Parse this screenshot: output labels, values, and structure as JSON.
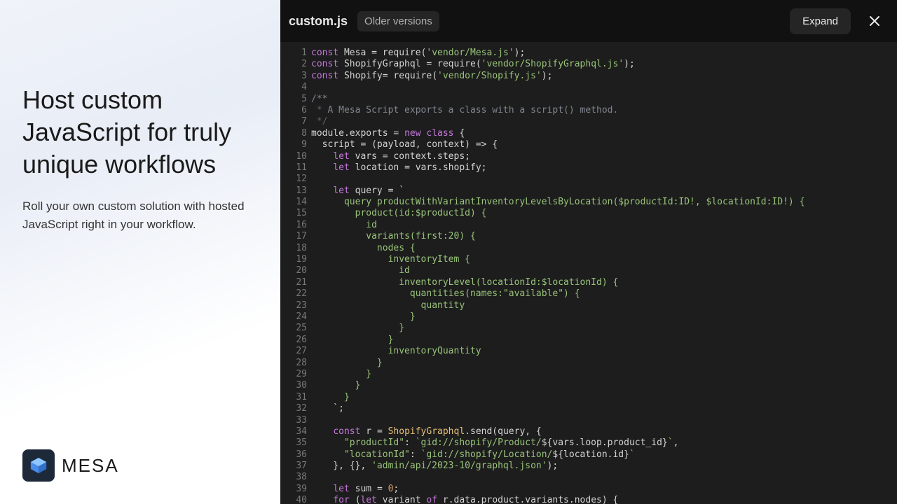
{
  "hero": {
    "title": "Host custom JavaScript for truly unique workflows",
    "subtitle": "Roll your own custom solution with hosted JavaScript right in your workflow."
  },
  "brand": {
    "name": "MESA"
  },
  "topbar": {
    "filename": "custom.js",
    "older_versions": "Older versions",
    "expand": "Expand"
  },
  "code": {
    "lines": [
      [
        {
          "c": "kw",
          "t": "const"
        },
        {
          "t": " Mesa "
        },
        {
          "t": "="
        },
        {
          "t": " require("
        },
        {
          "c": "str",
          "t": "'vendor/Mesa.js'"
        },
        {
          "t": ");"
        }
      ],
      [
        {
          "c": "kw",
          "t": "const"
        },
        {
          "t": " ShopifyGraphql "
        },
        {
          "t": "="
        },
        {
          "t": " require("
        },
        {
          "c": "str",
          "t": "'vendor/ShopifyGraphql.js'"
        },
        {
          "t": ");"
        }
      ],
      [
        {
          "c": "kw",
          "t": "const"
        },
        {
          "t": " Shopify"
        },
        {
          "t": "="
        },
        {
          "t": " require("
        },
        {
          "c": "str",
          "t": "'vendor/Shopify.js'"
        },
        {
          "t": ");"
        }
      ],
      [],
      [
        {
          "c": "com",
          "t": "/**"
        }
      ],
      [
        {
          "c": "com-bar",
          "t": " *"
        },
        {
          "c": "com",
          "t": " A Mesa Script exports a class with a script() method."
        }
      ],
      [
        {
          "c": "com-bar",
          "t": " */"
        }
      ],
      [
        {
          "t": "module.exports "
        },
        {
          "t": "="
        },
        {
          "t": " "
        },
        {
          "c": "new",
          "t": "new"
        },
        {
          "t": " "
        },
        {
          "c": "kw",
          "t": "class"
        },
        {
          "t": " {"
        }
      ],
      [
        {
          "t": "  script "
        },
        {
          "t": "="
        },
        {
          "t": " (payload, context) "
        },
        {
          "t": "=>"
        },
        {
          "t": " {"
        }
      ],
      [
        {
          "t": "    "
        },
        {
          "c": "kw",
          "t": "let"
        },
        {
          "t": " vars "
        },
        {
          "t": "="
        },
        {
          "t": " context.steps;"
        }
      ],
      [
        {
          "t": "    "
        },
        {
          "c": "kw",
          "t": "let"
        },
        {
          "t": " location "
        },
        {
          "t": "="
        },
        {
          "t": " vars.shopify;"
        }
      ],
      [],
      [
        {
          "t": "    "
        },
        {
          "c": "kw",
          "t": "let"
        },
        {
          "t": " query "
        },
        {
          "t": "="
        },
        {
          "t": " `"
        }
      ],
      [
        {
          "t": "      "
        },
        {
          "c": "tpl",
          "t": "query productWithVariantInventoryLevelsByLocation($productId:ID!, $locationId:ID!) {"
        }
      ],
      [
        {
          "t": "        "
        },
        {
          "c": "tpl",
          "t": "product(id:$productId) {"
        }
      ],
      [
        {
          "t": "          "
        },
        {
          "c": "tpl",
          "t": "id"
        }
      ],
      [
        {
          "t": "          "
        },
        {
          "c": "tpl",
          "t": "variants(first:20) {"
        }
      ],
      [
        {
          "t": "            "
        },
        {
          "c": "tpl",
          "t": "nodes {"
        }
      ],
      [
        {
          "t": "              "
        },
        {
          "c": "tpl",
          "t": "inventoryItem {"
        }
      ],
      [
        {
          "t": "                "
        },
        {
          "c": "tpl",
          "t": "id"
        }
      ],
      [
        {
          "t": "                "
        },
        {
          "c": "tpl",
          "t": "inventoryLevel(locationId:$locationId) {"
        }
      ],
      [
        {
          "t": "                  "
        },
        {
          "c": "tpl",
          "t": "quantities(names:\"available\") {"
        }
      ],
      [
        {
          "t": "                    "
        },
        {
          "c": "tpl",
          "t": "quantity"
        }
      ],
      [
        {
          "t": "                  "
        },
        {
          "c": "tpl",
          "t": "}"
        }
      ],
      [
        {
          "t": "                "
        },
        {
          "c": "tpl",
          "t": "}"
        }
      ],
      [
        {
          "t": "              "
        },
        {
          "c": "tpl",
          "t": "}"
        }
      ],
      [
        {
          "t": "              "
        },
        {
          "c": "tpl",
          "t": "inventoryQuantity"
        }
      ],
      [
        {
          "t": "            "
        },
        {
          "c": "tpl",
          "t": "}"
        }
      ],
      [
        {
          "t": "          "
        },
        {
          "c": "tpl",
          "t": "}"
        }
      ],
      [
        {
          "t": "        "
        },
        {
          "c": "tpl",
          "t": "}"
        }
      ],
      [
        {
          "t": "      "
        },
        {
          "c": "tpl",
          "t": "}"
        }
      ],
      [
        {
          "t": "    `;"
        }
      ],
      [],
      [
        {
          "t": "    "
        },
        {
          "c": "kw",
          "t": "const"
        },
        {
          "t": " r "
        },
        {
          "t": "="
        },
        {
          "t": " "
        },
        {
          "c": "fn",
          "t": "ShopifyGraphql"
        },
        {
          "t": ".send(query, {"
        }
      ],
      [
        {
          "t": "      "
        },
        {
          "c": "str",
          "t": "\"productId\""
        },
        {
          "t": ": "
        },
        {
          "c": "tpl",
          "t": "`gid://shopify/Product/"
        },
        {
          "t": "${vars.loop.product_id}"
        },
        {
          "c": "tpl",
          "t": "`"
        },
        {
          "t": ","
        }
      ],
      [
        {
          "t": "      "
        },
        {
          "c": "str",
          "t": "\"locationId\""
        },
        {
          "t": ": "
        },
        {
          "c": "tpl",
          "t": "`gid://shopify/Location/"
        },
        {
          "t": "${location.id}"
        },
        {
          "c": "tpl",
          "t": "`"
        }
      ],
      [
        {
          "t": "    }, {}, "
        },
        {
          "c": "str",
          "t": "'admin/api/2023-10/graphql.json'"
        },
        {
          "t": ");"
        }
      ],
      [],
      [
        {
          "t": "    "
        },
        {
          "c": "kw",
          "t": "let"
        },
        {
          "t": " sum "
        },
        {
          "t": "="
        },
        {
          "t": " "
        },
        {
          "c": "num",
          "t": "0"
        },
        {
          "t": ";"
        }
      ],
      [
        {
          "t": "    "
        },
        {
          "c": "kw",
          "t": "for"
        },
        {
          "t": " ("
        },
        {
          "c": "kw",
          "t": "let"
        },
        {
          "t": " variant "
        },
        {
          "c": "kw",
          "t": "of"
        },
        {
          "t": " r.data.product.variants.nodes) {"
        }
      ]
    ]
  }
}
